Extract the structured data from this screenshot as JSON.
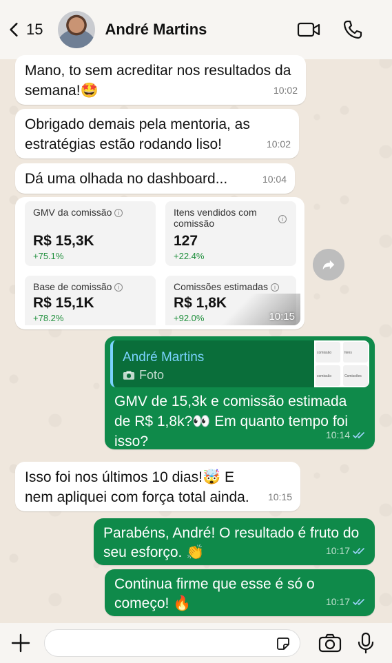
{
  "header": {
    "back_count": "15",
    "contact_name": "André Martins",
    "icons": [
      "chevron-left-icon",
      "video-call-icon",
      "phone-icon"
    ]
  },
  "messages": [
    {
      "dir": "in",
      "text": "Mano, to sem acreditar nos resultados da semana!🤩",
      "time": "10:02"
    },
    {
      "dir": "in",
      "text": "Obrigado demais pela mentoria, as estratégias estão rodando liso!",
      "time": "10:02"
    },
    {
      "dir": "in",
      "text": "Dá uma olhada no dashboard...",
      "time": "10:04"
    },
    {
      "dir": "out",
      "text": "GMV de 15,3k e comissão estimada de R$ 1,8k?👀 Em quanto tempo foi isso?",
      "time": "10:14"
    },
    {
      "dir": "in",
      "text": "Isso foi nos últimos 10 dias!🤯 E nem apliquei com força total ainda.",
      "time": "10:15"
    },
    {
      "dir": "out",
      "text": "Parabéns, André! O resultado é fruto do seu esforço. 👏",
      "time": "10:17"
    },
    {
      "dir": "out",
      "text": "Continua firme que esse é só o começo! 🔥",
      "time": "10:17"
    }
  ],
  "dashboard": {
    "time": "10:15",
    "cards": [
      {
        "label": "GMV da comissão",
        "value": "R$ 15,3K",
        "delta": "+75.1%"
      },
      {
        "label": "Itens vendidos com comissão",
        "value": "127",
        "delta": "+22.4%"
      },
      {
        "label": "Base de comissão",
        "value": "R$ 15,1K",
        "delta": "+78.2%"
      },
      {
        "label": "Comissões estimadas",
        "value": "R$ 1,8K",
        "delta": "+92.0%"
      }
    ]
  },
  "reply": {
    "quoted_name": "André Martins",
    "quoted_kind": "Foto"
  },
  "composer": {
    "placeholder": ""
  },
  "colors": {
    "outgoing": "#0f8a4a",
    "incoming": "#ffffff",
    "background": "#efe7dd",
    "quote_accent": "#7bd3ff"
  }
}
